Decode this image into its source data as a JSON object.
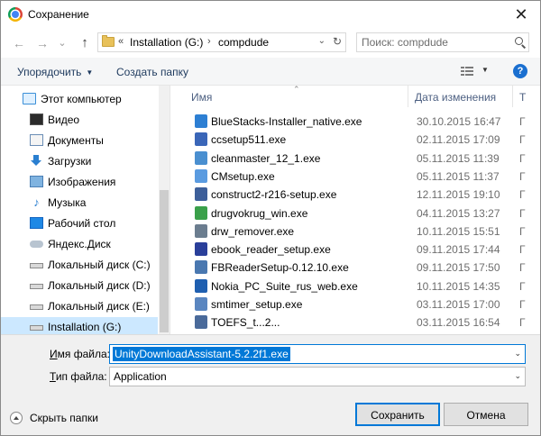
{
  "window": {
    "title": "Сохранение",
    "close_glyph": "✕"
  },
  "nav": {
    "back_glyph": "←",
    "forward_glyph": "→",
    "down_glyph": "⌄",
    "up_glyph": "↑",
    "address": {
      "chevrons": "«",
      "segments": [
        "Installation (G:)",
        "compdude"
      ],
      "sep": "›",
      "dropdown_glyph": "⌄",
      "refresh_glyph": "↻"
    },
    "search_placeholder": "Поиск: compdude"
  },
  "toolbar": {
    "organize_label": "Упорядочить",
    "caret": "▼",
    "new_folder_label": "Создать папку",
    "help_glyph": "?"
  },
  "tree": {
    "items": [
      {
        "label": "Этот компьютер",
        "icon": "computer-icon",
        "icls": "ic-pc"
      },
      {
        "label": "Видео",
        "icon": "video-folder-icon",
        "icls": "ic-video"
      },
      {
        "label": "Документы",
        "icon": "documents-folder-icon",
        "icls": "ic-docs"
      },
      {
        "label": "Загрузки",
        "icon": "downloads-folder-icon",
        "icls": "ic-down"
      },
      {
        "label": "Изображения",
        "icon": "pictures-folder-icon",
        "icls": "ic-img"
      },
      {
        "label": "Музыка",
        "icon": "music-folder-icon",
        "icls": "ic-music"
      },
      {
        "label": "Рабочий стол",
        "icon": "desktop-folder-icon",
        "icls": "ic-desk"
      },
      {
        "label": "Яндекс.Диск",
        "icon": "yandex-disk-icon",
        "icls": "ic-yadisk"
      },
      {
        "label": "Локальный диск (C:)",
        "icon": "drive-icon",
        "icls": "ic-disk"
      },
      {
        "label": "Локальный диск (D:)",
        "icon": "drive-icon",
        "icls": "ic-disk"
      },
      {
        "label": "Локальный диск (E:)",
        "icon": "drive-icon",
        "icls": "ic-disk"
      },
      {
        "label": "Installation (G:)",
        "icon": "drive-icon",
        "icls": "ic-disk",
        "selected": true
      }
    ]
  },
  "files": {
    "columns": {
      "name": "Имя",
      "date": "Дата изменения",
      "type": "Т"
    },
    "rows": [
      {
        "name": "BlueStacks-Installer_native.exe",
        "date": "30.10.2015 16:47",
        "type": "Г",
        "color": "#2d7fd3"
      },
      {
        "name": "ccsetup511.exe",
        "date": "02.11.2015 17:09",
        "type": "Г",
        "color": "#3a66b8"
      },
      {
        "name": "cleanmaster_12_1.exe",
        "date": "05.11.2015 11:39",
        "type": "Г",
        "color": "#4a8fd0"
      },
      {
        "name": "CMsetup.exe",
        "date": "05.11.2015 11:37",
        "type": "Г",
        "color": "#5a9be0"
      },
      {
        "name": "construct2-r216-setup.exe",
        "date": "12.11.2015 19:10",
        "type": "Г",
        "color": "#3d5f9a"
      },
      {
        "name": "drugvokrug_win.exe",
        "date": "04.11.2015 13:27",
        "type": "Г",
        "color": "#3aa04a"
      },
      {
        "name": "drw_remover.exe",
        "date": "10.11.2015 15:51",
        "type": "Г",
        "color": "#6b7d8f"
      },
      {
        "name": "ebook_reader_setup.exe",
        "date": "09.11.2015 17:44",
        "type": "Г",
        "color": "#2a3f9a"
      },
      {
        "name": "FBReaderSetup-0.12.10.exe",
        "date": "09.11.2015 17:50",
        "type": "Г",
        "color": "#4a78b0"
      },
      {
        "name": "Nokia_PC_Suite_rus_web.exe",
        "date": "10.11.2015 14:35",
        "type": "Г",
        "color": "#1f5fb0"
      },
      {
        "name": "smtimer_setup.exe",
        "date": "03.11.2015 17:00",
        "type": "Г",
        "color": "#5a86c0"
      },
      {
        "name": "TOEFS_t...2...",
        "date": "03.11.2015 16:54",
        "type": "Г",
        "color": "#4a6a9a"
      }
    ]
  },
  "form": {
    "filename_label_u": "И",
    "filename_label_rest": "мя файла:",
    "filename_value": "UnityDownloadAssistant-5.2.2f1.exe",
    "filetype_label_u": "Т",
    "filetype_label_rest": "ип файла:",
    "filetype_value": "Application",
    "combo_caret": "⌄",
    "hide_folders_label": "Скрыть папки",
    "save_button": "Сохранить",
    "cancel_button": "Отмена"
  }
}
